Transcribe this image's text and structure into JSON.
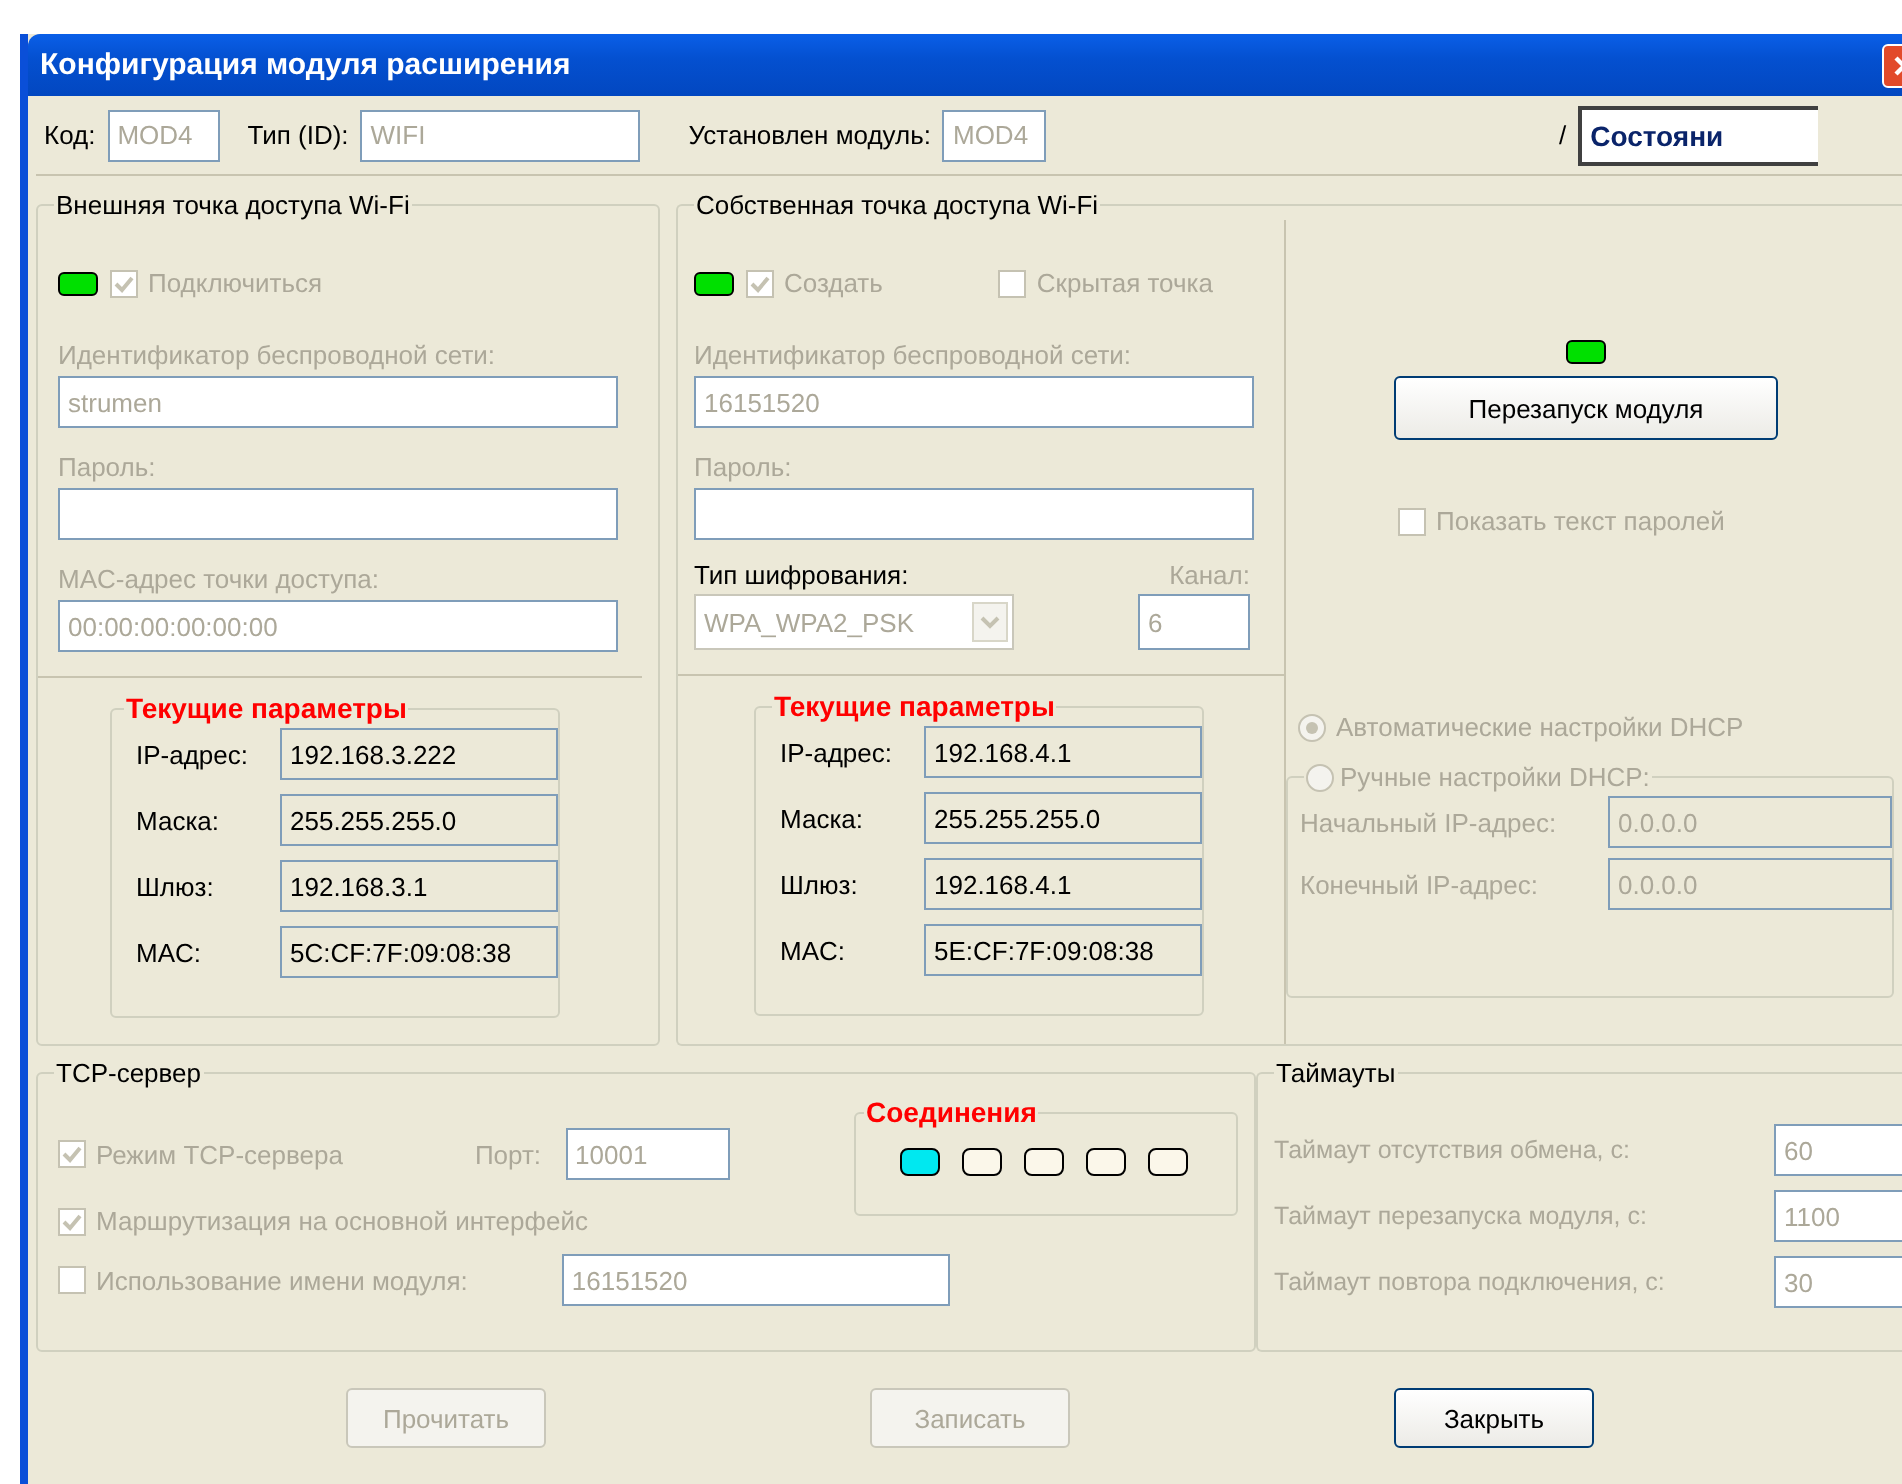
{
  "window": {
    "title": "Конфигурация модуля расширения"
  },
  "header": {
    "code_label": "Код:",
    "code_value": "MOD4",
    "type_label": "Тип (ID):",
    "type_value": "WIFI",
    "installed_label": "Установлен модуль:",
    "installed_value": "MOD4",
    "separator": "/",
    "status_tab": "Состояни"
  },
  "external_ap": {
    "title": "Внешняя точка доступа Wi-Fi",
    "led_on": true,
    "connect": {
      "label": "Подключиться",
      "checked": true
    },
    "fields": [
      {
        "label": "Идентификатор беспроводной сети:",
        "value": "strumen"
      },
      {
        "label": "Пароль:"
      },
      {
        "label": "MAC-адрес точки доступа:",
        "value": "00:00:00:00:00:00"
      }
    ],
    "current": {
      "title": "Текущие параметры",
      "rows": [
        {
          "label": "IP-адрес:",
          "value": "192.168.3.222"
        },
        {
          "label": "Маска:",
          "value": "255.255.255.0"
        },
        {
          "label": "Шлюз:",
          "value": "192.168.3.1"
        },
        {
          "label": "MAC:",
          "value": "5C:CF:7F:09:08:38"
        }
      ]
    }
  },
  "own_ap": {
    "title": "Собственная точка доступа Wi-Fi",
    "led_on": true,
    "create": {
      "label": "Создать",
      "checked": true
    },
    "hidden": {
      "label": "Скрытая точка",
      "checked": false
    },
    "fields": [
      {
        "label": "Идентификатор беспроводной сети:",
        "value": "16151520"
      },
      {
        "label": "Пароль:"
      }
    ],
    "encryption": {
      "label": "Тип шифрования:",
      "value": "WPA_WPA2_PSK"
    },
    "channel": {
      "label": "Канал:",
      "value": "6"
    },
    "current": {
      "title": "Текущие параметры",
      "rows": [
        {
          "label": "IP-адрес:",
          "value": "192.168.4.1"
        },
        {
          "label": "Маска:",
          "value": "255.255.255.0"
        },
        {
          "label": "Шлюз:",
          "value": "192.168.4.1"
        },
        {
          "label": "MAC:",
          "value": "5E:CF:7F:09:08:38"
        }
      ]
    }
  },
  "module": {
    "led_on": true,
    "restart_button": "Перезапуск модуля",
    "show_passwords": {
      "label": "Показать текст паролей",
      "checked": false
    }
  },
  "dhcp": {
    "auto": {
      "label": "Автоматические настройки DHCP",
      "selected": true
    },
    "manual": {
      "label": "Ручные настройки DHCP:",
      "selected": false
    },
    "fields": [
      {
        "label": "Начальный IP-адрес:",
        "value": "0.0.0.0"
      },
      {
        "label": "Конечный IP-адрес:",
        "value": "0.0.0.0"
      }
    ]
  },
  "tcp": {
    "title": "TCP-сервер",
    "server_mode": {
      "label": "Режим TCP-сервера",
      "checked": true
    },
    "port": {
      "label": "Порт:",
      "value": "10001"
    },
    "routing": {
      "label": "Маршрутизация на основной интерфейс",
      "checked": true
    },
    "use_name": {
      "label": "Использование имени модуля:",
      "checked": false,
      "value": "16151520"
    },
    "connections": {
      "title": "Соединения",
      "slots": [
        {
          "active": true
        },
        {
          "active": false
        },
        {
          "active": false
        },
        {
          "active": false
        },
        {
          "active": false
        }
      ]
    }
  },
  "timeouts": {
    "title": "Таймауты",
    "rows": [
      {
        "label": "Таймаут отсутствия обмена, с:",
        "value": "60"
      },
      {
        "label": "Таймаут перезапуска модуля, с:",
        "value": "1100"
      },
      {
        "label": "Таймаут повтора подключения, с:",
        "value": "30"
      }
    ]
  },
  "buttons": [
    {
      "label": "Прочитать",
      "disabled": true
    },
    {
      "label": "Записать",
      "disabled": true
    },
    {
      "label": "Закрыть",
      "disabled": false
    }
  ]
}
